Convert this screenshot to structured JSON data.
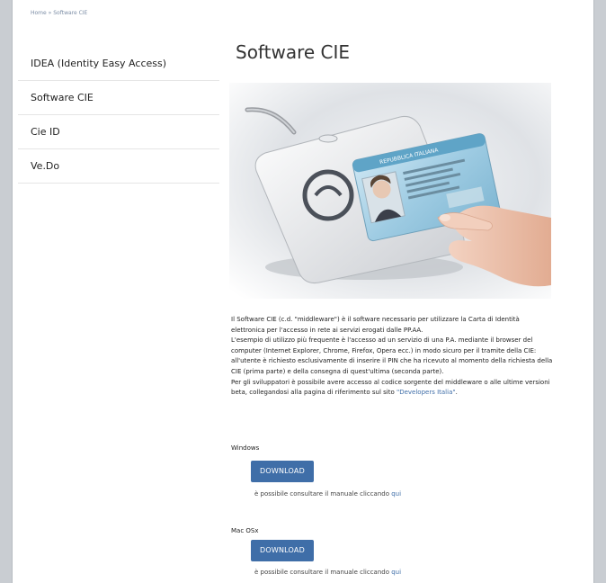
{
  "breadcrumb": {
    "home": "Home",
    "separator": "»",
    "current": "Software CIE"
  },
  "sidebar": {
    "items": [
      {
        "label": "IDEA (Identity Easy Access)"
      },
      {
        "label": "Software CIE"
      },
      {
        "label": "Cie ID"
      },
      {
        "label": "Ve.Do"
      }
    ]
  },
  "main": {
    "title": "Software CIE",
    "hero_icon": "cie-card-reader-image",
    "card_label": "REPUBBLICA ITALIANA",
    "description": {
      "p1": "Il Software CIE (c.d. \"middleware\") è il software necessario per utilizzare la Carta di Identità elettronica per l'accesso in rete ai servizi erogati dalle PP.AA.",
      "p2": "L'esempio di utilizzo più frequente è l'accesso ad un servizio di una P.A. mediante il browser del computer (Internet Explorer, Chrome, Firefox, Opera ecc.) in modo sicuro per il tramite della CIE: all'utente è richiesto esclusivamente di inserire il PIN che ha ricevuto al momento della richiesta della CIE (prima parte) e della consegna di quest'ultima (seconda parte).",
      "p3_text": "Per gli sviluppatori è possibile avere accesso al codice sorgente del middleware o alle ultime versioni beta, collegandosi alla pagina di riferimento sul sito ",
      "p3_link": "\"Developers Italia\"",
      "p3_end": "."
    },
    "downloads": [
      {
        "os": "Windows",
        "button": "DOWNLOAD",
        "manual_text": "è possibile consultare il manuale cliccando ",
        "manual_link": "qui"
      },
      {
        "os": "Mac OSx",
        "button": "DOWNLOAD",
        "manual_text": "è possibile consultare il manuale cliccando ",
        "manual_link": "qui"
      }
    ]
  },
  "colors": {
    "accent": "#3f6ea8",
    "page_bg": "#c9cdd2"
  }
}
